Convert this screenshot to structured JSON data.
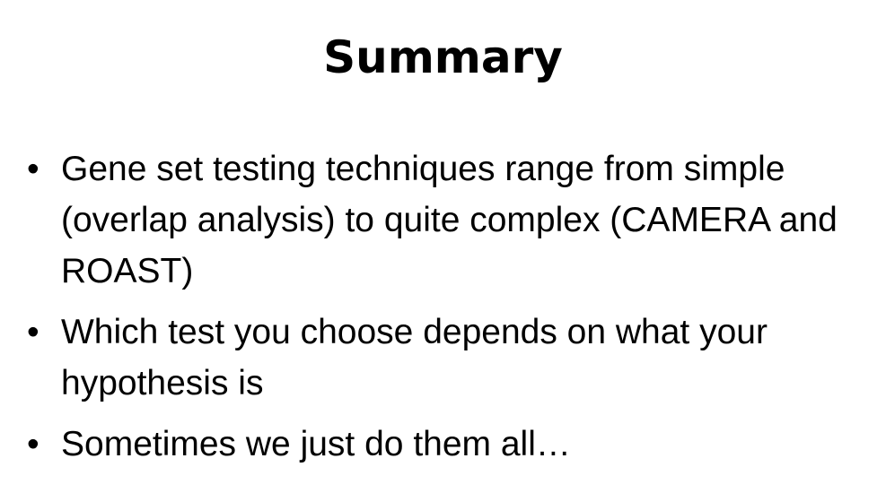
{
  "slide": {
    "title": "Summary",
    "bullets": [
      {
        "text": "Gene set testing techniques range from simple (overlap analysis) to quite complex (CAMERA and ROAST)"
      },
      {
        "text": "Which test you choose depends on what your hypothesis is"
      },
      {
        "text": "Sometimes we just do them all…"
      }
    ],
    "bullet_glyph": "•"
  }
}
